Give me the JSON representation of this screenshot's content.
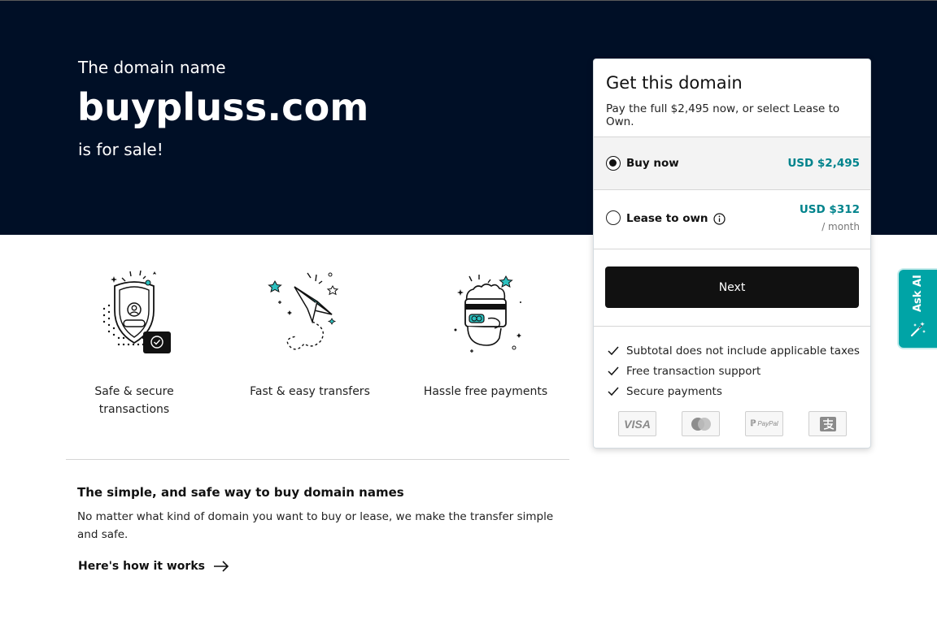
{
  "hero": {
    "intro": "The domain name",
    "domain": "buypluss.com",
    "for_sale": "is for sale!"
  },
  "features": [
    {
      "label_line1": "Safe & secure",
      "label_line2": "transactions",
      "icon": "shield-check-icon"
    },
    {
      "label_line1": "Fast & easy transfers",
      "icon": "paper-plane-icon"
    },
    {
      "label_line1": "Hassle free payments",
      "icon": "hand-card-icon"
    }
  ],
  "simple": {
    "title": "The simple, and safe way to buy domain names",
    "description": "No matter what kind of domain you want to buy or lease, we make the transfer simple and safe.",
    "link_label": "Here's how it works"
  },
  "purchase_card": {
    "title": "Get this domain",
    "subtitle": "Pay the full $2,495 now, or select Lease to Own.",
    "options": [
      {
        "label": "Buy now",
        "price": "USD $2,495",
        "selected": true
      },
      {
        "label": "Lease to own",
        "price": "USD $312",
        "period": "/ month",
        "selected": false
      }
    ],
    "next_label": "Next",
    "checks": [
      "Subtotal does not include applicable taxes",
      "Free transaction support",
      "Secure payments"
    ],
    "payment_methods": [
      "VISA",
      "mastercard-icon",
      "PayPal",
      "alipay-icon"
    ]
  },
  "ask_ai": {
    "label": "Ask AI"
  },
  "colors": {
    "hero_bg": "#000f26",
    "accent": "#00838c",
    "ask_ai_bg": "#00a4a6",
    "button_bg": "#111111"
  }
}
